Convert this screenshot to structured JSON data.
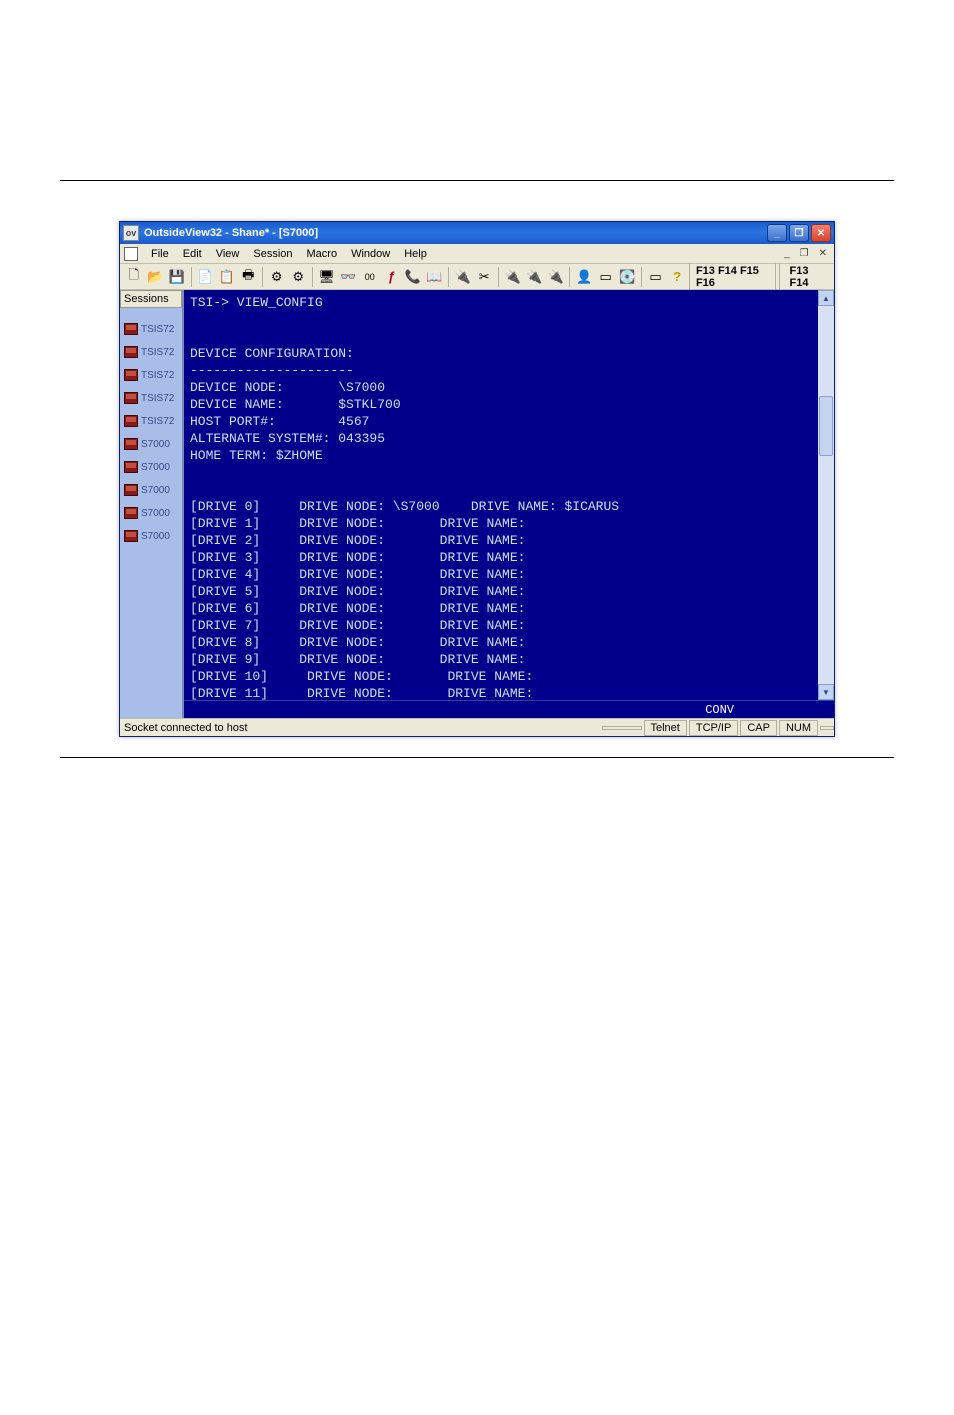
{
  "window": {
    "title": "OutsideView32 - Shane* - [S7000]"
  },
  "menu": {
    "items": [
      "File",
      "Edit",
      "View",
      "Session",
      "Macro",
      "Window",
      "Help"
    ]
  },
  "fkeys": {
    "left": "F13 F14 F15 F16",
    "right": "F13 F14"
  },
  "sessions": {
    "header": "Sessions",
    "items": [
      {
        "label": "TSIS72"
      },
      {
        "label": "TSIS72"
      },
      {
        "label": "TSIS72"
      },
      {
        "label": "TSIS72"
      },
      {
        "label": "TSIS72"
      },
      {
        "label": "S7000"
      },
      {
        "label": "S7000"
      },
      {
        "label": "S7000"
      },
      {
        "label": "S7000"
      },
      {
        "label": "S7000"
      }
    ]
  },
  "terminal": {
    "lines": [
      "TSI-> VIEW_CONFIG",
      "",
      "",
      "DEVICE CONFIGURATION:",
      "---------------------",
      "DEVICE NODE:       \\S7000",
      "DEVICE NAME:       $STKL700",
      "HOST PORT#:        4567",
      "ALTERNATE SYSTEM#: 043395",
      "HOME TERM: $ZHOME",
      "",
      "",
      "[DRIVE 0]     DRIVE NODE: \\S7000    DRIVE NAME: $ICARUS",
      "[DRIVE 1]     DRIVE NODE:       DRIVE NAME:",
      "[DRIVE 2]     DRIVE NODE:       DRIVE NAME:",
      "[DRIVE 3]     DRIVE NODE:       DRIVE NAME:",
      "[DRIVE 4]     DRIVE NODE:       DRIVE NAME:",
      "[DRIVE 5]     DRIVE NODE:       DRIVE NAME:",
      "[DRIVE 6]     DRIVE NODE:       DRIVE NAME:",
      "[DRIVE 7]     DRIVE NODE:       DRIVE NAME:",
      "[DRIVE 8]     DRIVE NODE:       DRIVE NAME:",
      "[DRIVE 9]     DRIVE NODE:       DRIVE NAME:",
      "[DRIVE 10]     DRIVE NODE:       DRIVE NAME:",
      "[DRIVE 11]     DRIVE NODE:       DRIVE NAME:"
    ],
    "mode": "CONV"
  },
  "status": {
    "text": "Socket connected to host",
    "cells": [
      "",
      "Telnet",
      "TCP/IP",
      "CAP",
      "NUM",
      ""
    ]
  },
  "icons": {
    "new": "🗋",
    "open": "📂",
    "save": "💾",
    "copy": "📄",
    "paste": "📋",
    "print": "🖶",
    "gear1": "⚙",
    "gear2": "⚙",
    "mon": "🖥",
    "glasses": "👓",
    "bits": "00",
    "fx": "ƒ",
    "phone": "📞",
    "book": "📖",
    "plug1": "🔌",
    "plug2": "✂",
    "sp1": "🔌",
    "sp2": "🔌",
    "sp3": "🔌",
    "person": "👤",
    "box": "▭",
    "disk": "💽",
    "rect": "▭",
    "help": "?"
  }
}
